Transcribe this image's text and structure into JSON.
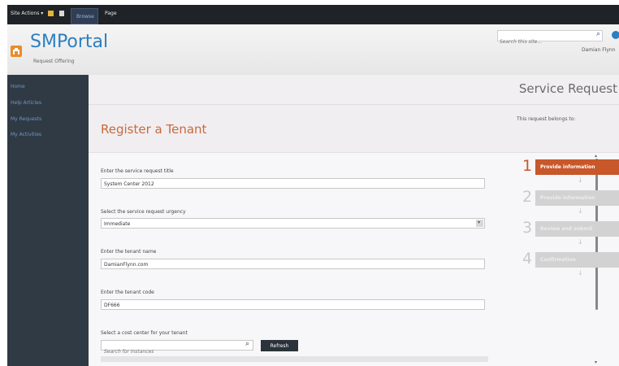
{
  "ribbon": {
    "site_actions": "Site Actions ▾",
    "tab_browse": "Browse",
    "tab_page": "Page"
  },
  "header": {
    "site_title": "SMPortal",
    "breadcrumb": "Request Offering",
    "search_placeholder": "Search this site...",
    "user": "Damian Flynn"
  },
  "nav": {
    "items": [
      "Home",
      "Help Articles",
      "My Requests",
      "My Activities"
    ]
  },
  "page": {
    "service_title": "Service Request",
    "form_title": "Register a Tenant",
    "belongs_label": "This request belongs to:"
  },
  "form": {
    "title_label": "Enter the service request title",
    "title_value": "System Center 2012",
    "urgency_label": "Select the service request urgency",
    "urgency_value": "Immediate",
    "tenant_name_label": "Enter the tenant name",
    "tenant_name_value": "DamianFlynn.com",
    "tenant_code_label": "Enter the tenant code",
    "tenant_code_value": "DF666",
    "cost_center_label": "Select a cost center for your tenant",
    "search_placeholder": "Search for instances",
    "refresh_label": "Refresh"
  },
  "steps": [
    {
      "num": "1",
      "label": "Provide information",
      "active": true
    },
    {
      "num": "2",
      "label": "Provide information",
      "active": false
    },
    {
      "num": "3",
      "label": "Review and submit",
      "active": false
    },
    {
      "num": "4",
      "label": "Confirmation",
      "active": false
    }
  ],
  "colors": {
    "accent": "#c8572a",
    "brand": "#2b7fc1",
    "nav_bg": "#303a44"
  }
}
